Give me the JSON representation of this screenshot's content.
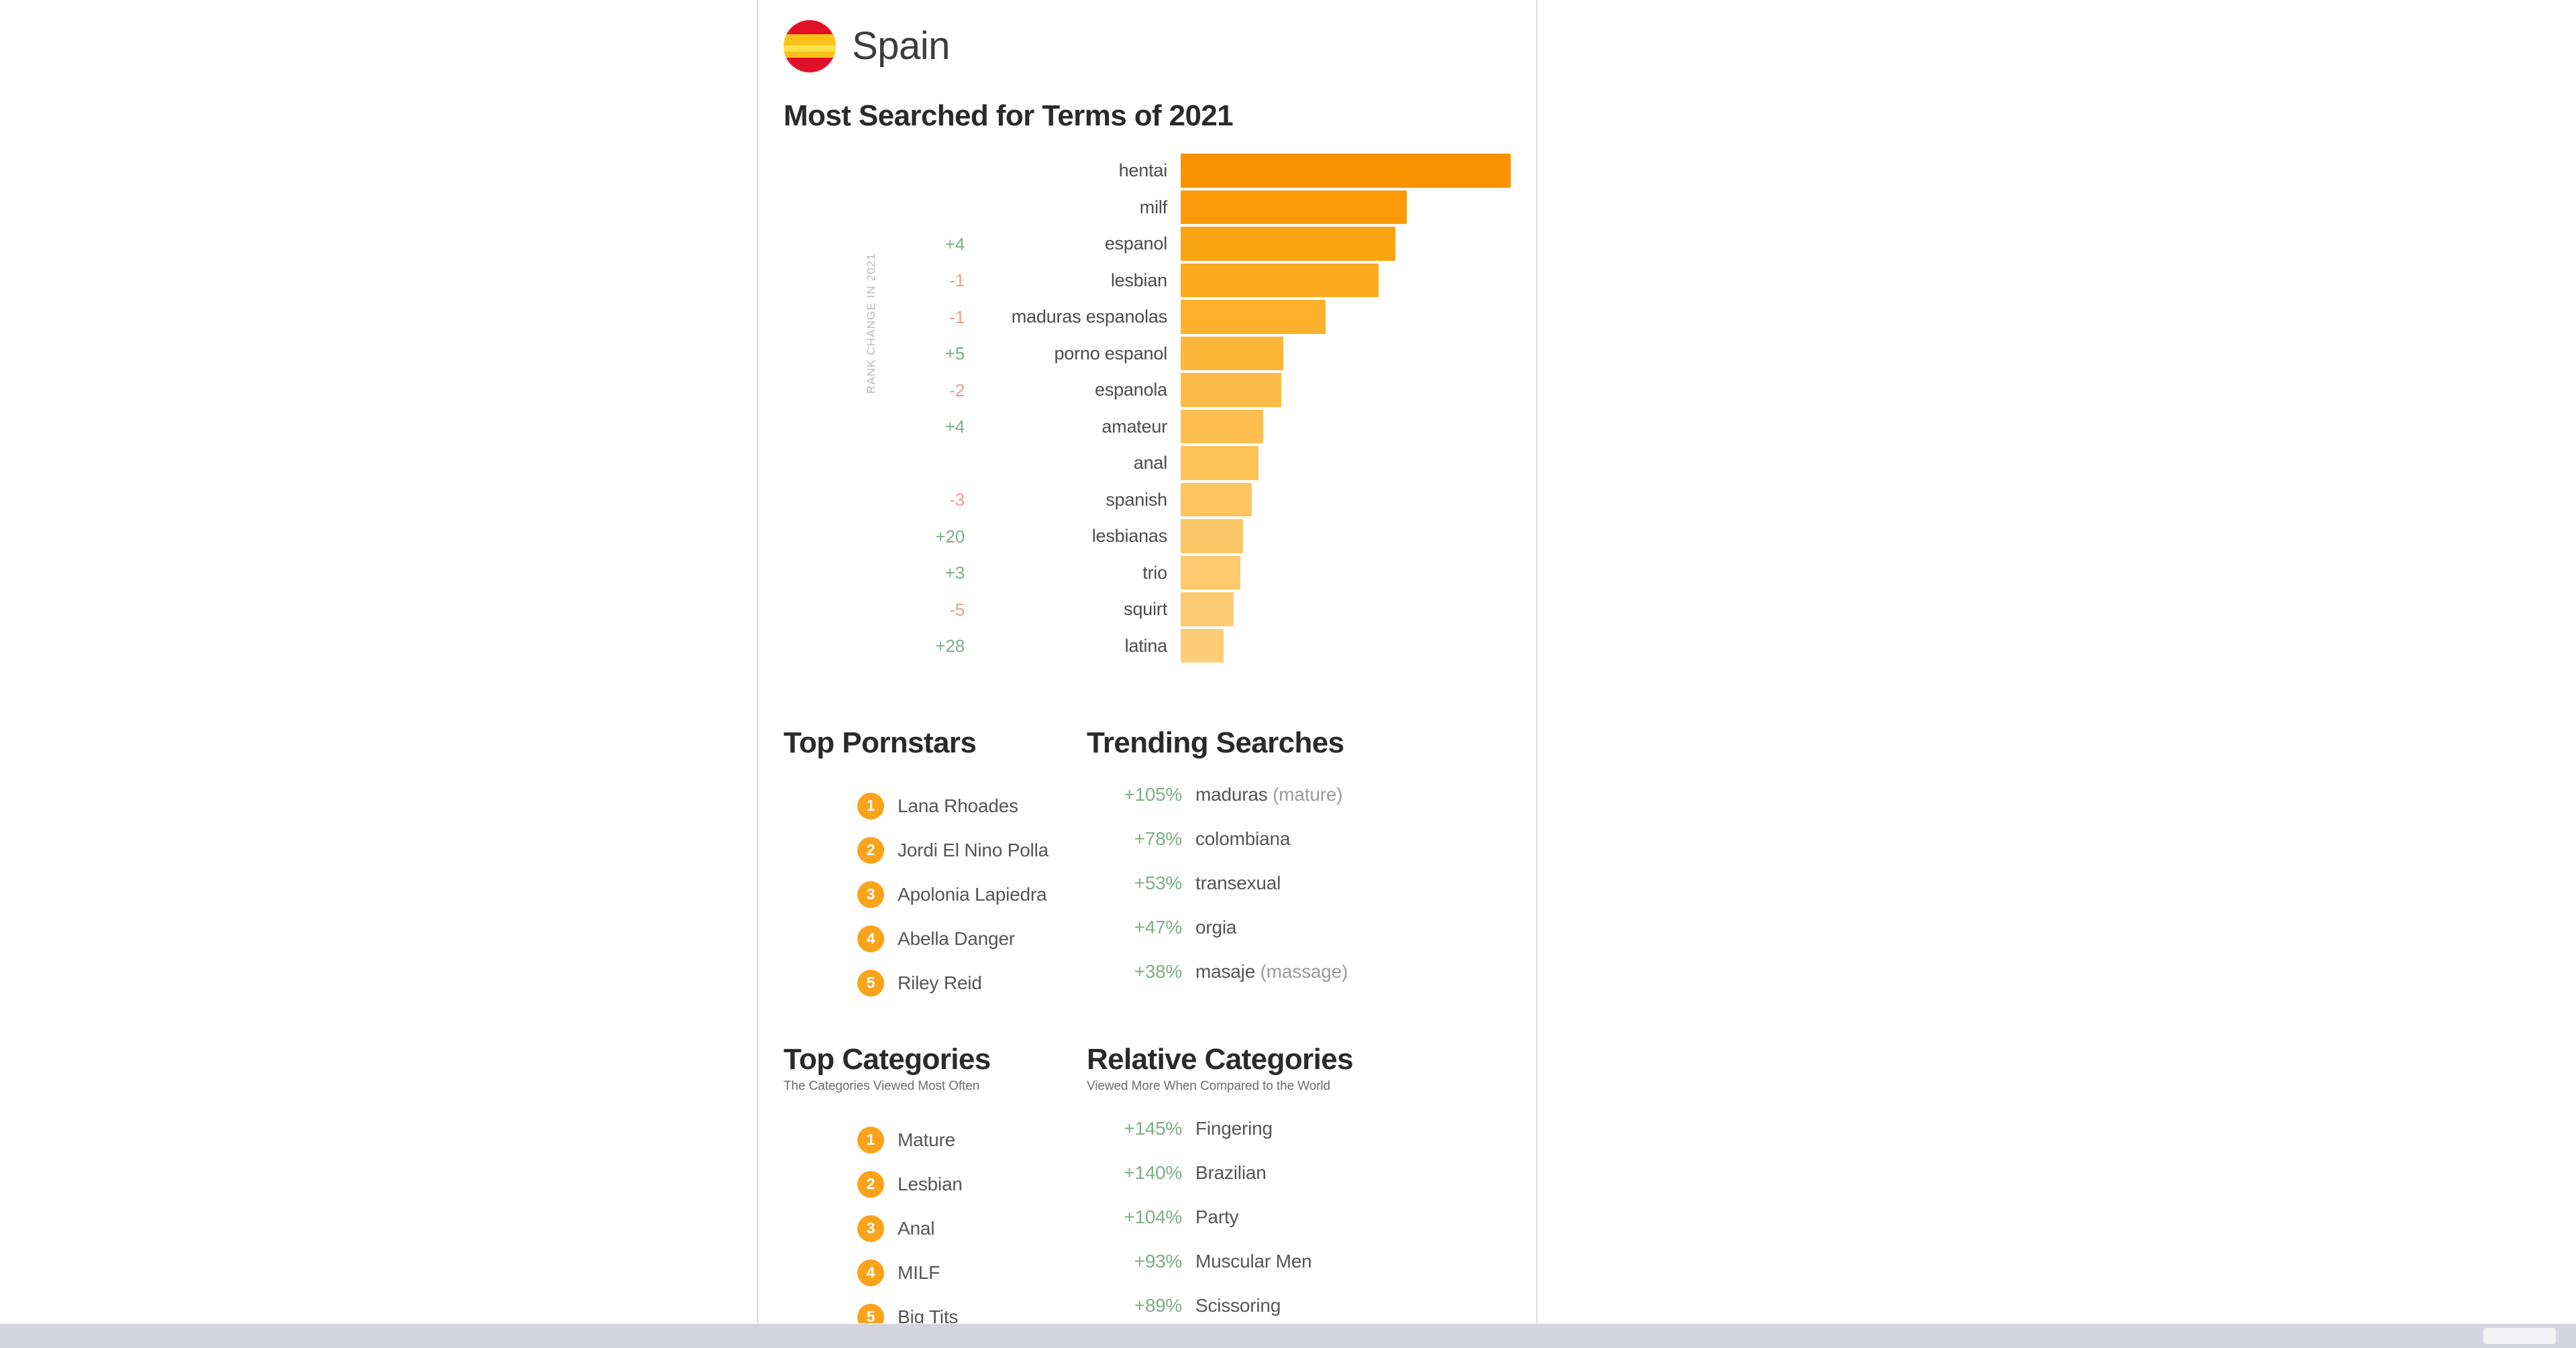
{
  "country": {
    "name": "Spain",
    "flag_icon": "spain-flag-circle"
  },
  "main_section": {
    "title": "Most Searched for Terms of 2021"
  },
  "chart_data": {
    "type": "bar",
    "title": "Most Searched for Terms of 2021",
    "xlabel": "",
    "ylabel": "RANK CHANGE IN 2021",
    "axis_note": "RANK CHANGE IN 2021",
    "orientation": "horizontal",
    "grid": false,
    "legend": "none",
    "value_unit": "relative search volume (bar length, unlabeled)",
    "categories": [
      "hentai",
      "milf",
      "espanol",
      "lesbian",
      "maduras espanolas",
      "porno espanol",
      "espanola",
      "amateur",
      "anal",
      "spanish",
      "lesbianas",
      "trio",
      "squirt",
      "latina"
    ],
    "values": [
      100,
      68.5,
      65,
      60,
      44,
      31,
      30.5,
      25,
      23.5,
      21.5,
      19,
      18,
      16,
      13
    ],
    "rank_changes": [
      "",
      "",
      "+4",
      "-1",
      "-1",
      "+5",
      "-2",
      "+4",
      "",
      "-3",
      "+20",
      "+3",
      "-5",
      "+28"
    ],
    "bar_colors": [
      "#fa9200",
      "#fb9b09",
      "#fba412",
      "#fcab1f",
      "#fcb22c",
      "#fcb739",
      "#fcbb44",
      "#fcbf4f",
      "#fcc258",
      "#fcc560",
      "#fcc766",
      "#fcc96c",
      "#fccb71",
      "#fccd76"
    ]
  },
  "top_pornstars": {
    "title": "Top Pornstars",
    "items": [
      {
        "rank": "1",
        "name": "Lana Rhoades"
      },
      {
        "rank": "2",
        "name": "Jordi El Nino Polla"
      },
      {
        "rank": "3",
        "name": "Apolonia Lapiedra"
      },
      {
        "rank": "4",
        "name": "Abella Danger"
      },
      {
        "rank": "5",
        "name": "Riley Reid"
      }
    ]
  },
  "trending_searches": {
    "title": "Trending Searches",
    "items": [
      {
        "pct": "+105%",
        "term": "maduras ",
        "note": "(mature)"
      },
      {
        "pct": "+78%",
        "term": "colombiana",
        "note": ""
      },
      {
        "pct": "+53%",
        "term": "transexual",
        "note": ""
      },
      {
        "pct": "+47%",
        "term": "orgia",
        "note": ""
      },
      {
        "pct": "+38%",
        "term": "masaje ",
        "note": "(massage)"
      }
    ]
  },
  "top_categories": {
    "title": "Top Categories",
    "subtitle": "The Categories Viewed Most Often",
    "items": [
      {
        "rank": "1",
        "name": "Mature"
      },
      {
        "rank": "2",
        "name": "Lesbian"
      },
      {
        "rank": "3",
        "name": "Anal"
      },
      {
        "rank": "4",
        "name": "MILF"
      },
      {
        "rank": "5",
        "name": "Big Tits"
      }
    ]
  },
  "relative_categories": {
    "title": "Relative Categories",
    "subtitle": "Viewed More When Compared to the World",
    "items": [
      {
        "pct": "+145%",
        "term": "Fingering",
        "note": ""
      },
      {
        "pct": "+140%",
        "term": "Brazilian",
        "note": ""
      },
      {
        "pct": "+104%",
        "term": "Party",
        "note": ""
      },
      {
        "pct": "+93%",
        "term": "Muscular Men",
        "note": ""
      },
      {
        "pct": "+89%",
        "term": "Scissoring",
        "note": ""
      }
    ]
  },
  "colors": {
    "accent_orange": "#faa31b",
    "bar_top": "#fa9200",
    "bar_bottom": "#fccd76",
    "positive_green": "#7fae87",
    "negative_red": "#e8a093",
    "text_dark": "#2a2a2a",
    "text_body": "#555555"
  }
}
